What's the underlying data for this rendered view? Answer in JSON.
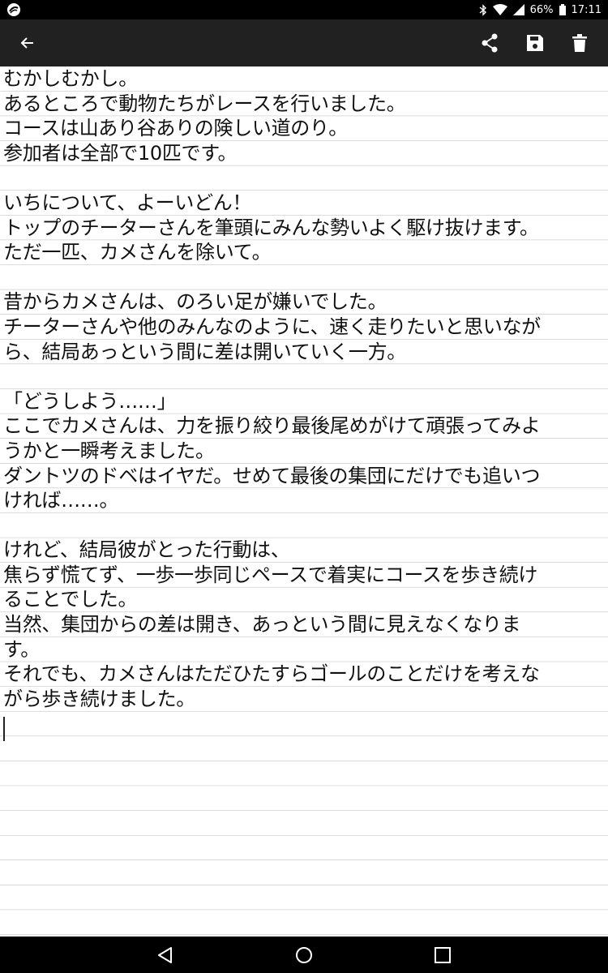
{
  "status_bar": {
    "battery": "66%",
    "time": "17:11",
    "icons": [
      "app-notification-icon",
      "bluetooth-icon",
      "wifi-icon",
      "signal-icon",
      "battery-icon"
    ]
  },
  "toolbar": {
    "background": "#212121",
    "icons": [
      "back-arrow-icon",
      "share-icon",
      "save-icon",
      "delete-icon"
    ]
  },
  "editor": {
    "lines": [
      "むかしむかし。",
      "あるところで動物たちがレースを行いました。",
      "コースは山あり谷ありの険しい道のり。",
      "参加者は全部で10匹です。",
      "",
      "いちについて、よーいどん！",
      "トップのチーターさんを筆頭にみんな勢いよく駆け抜けます。",
      "ただ一匹、カメさんを除いて。",
      "",
      "昔からカメさんは、のろい足が嫌いでした。",
      "チーターさんや他のみんなのように、速く走りたいと思いなが",
      "ら、結局あっという間に差は開いていく一方。",
      "",
      "「どうしよう……」",
      "ここでカメさんは、力を振り絞り最後尾めがけて頑張ってみよ",
      "うかと一瞬考えました。",
      "ダントツのドベはイヤだ。せめて最後の集団にだけでも追いつ",
      "ければ……。",
      "",
      "けれど、結局彼がとった行動は、",
      "焦らず慌てず、一歩一歩同じペースで着実にコースを歩き続け",
      "ることでした。",
      "当然、集団からの差は開き、あっという間に見えなくなりま",
      "す。",
      "それでも、カメさんはただひたすらゴールのことだけを考えな",
      "がら歩き続けました。"
    ]
  },
  "nav_bar": {
    "icons": [
      "nav-back-icon",
      "nav-home-icon",
      "nav-recents-icon"
    ]
  }
}
